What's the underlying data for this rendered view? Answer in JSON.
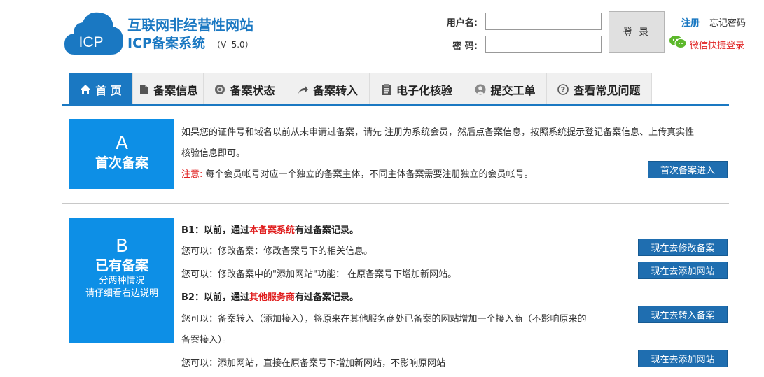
{
  "header": {
    "logo_text": "ICP",
    "site_title": "互联网非经营性网站",
    "sys_title": "ICP备案系统",
    "version": "（V- 5.0）"
  },
  "login": {
    "username_label": "用户名:",
    "password_label": "密 码:",
    "username_value": "",
    "password_value": "",
    "login_button": "登 录",
    "register_link": "注册",
    "forget_link": "忘记密码",
    "wechat_link": "微信快捷登录"
  },
  "nav": {
    "items": [
      {
        "label": "首 页",
        "icon": "home-icon"
      },
      {
        "label": "备案信息",
        "icon": "document-icon"
      },
      {
        "label": "备案状态",
        "icon": "status-icon"
      },
      {
        "label": "备案转入",
        "icon": "share-arrow-icon"
      },
      {
        "label": "电子化核验",
        "icon": "clipboard-icon"
      },
      {
        "label": "提交工单",
        "icon": "user-icon"
      },
      {
        "label": "查看常见问题",
        "icon": "question-icon"
      }
    ]
  },
  "section_a": {
    "letter": "A",
    "title": "首次备案",
    "desc_line1": "如果您的证件号和域名以前从未申请过备案，请先 注册为系统会员，然后点备案信息，按照系统提示登记备案信息、上传真实性",
    "desc_line2": "核验信息即可。",
    "note_label": "注意:",
    "note_text": " 每个会员帐号对应一个独立的备案主体，不同主体备案需要注册独立的会员帐号。",
    "button": "首次备案进入"
  },
  "section_b": {
    "letter": "B",
    "title": "已有备案",
    "sub1": "分两种情况",
    "sub2": "请仔细看右边说明",
    "b1_prefix": "B1：以前，通过",
    "b1_highlight": "本备案系统",
    "b1_suffix": "有过备案记录。",
    "b1_line1": "您可以：修改备案：修改备案号下的相关信息。",
    "b1_line2": "您可以：修改备案中的\"添加网站\"功能：  在原备案号下增加新网站。",
    "b1_btn1": "现在去修改备案",
    "b1_btn2": "现在去添加网站",
    "b2_prefix": "B2：以前，通过",
    "b2_highlight": "其他服务商",
    "b2_suffix": "有过备案记录。",
    "b2_line1": "您可以：备案转入（添加接入），将原来在其他服务商处已备案的网站增加一个接入商（不影响原来的",
    "b2_line1b": "备案接入）。",
    "b2_line2": "您可以：添加网站，直接在原备案号下增加新网站，不影响原网站",
    "b2_btn1": "现在去转入备案",
    "b2_btn2": "现在去添加网站"
  },
  "colors": {
    "primary": "#1a78c2",
    "box_blue": "#0d8fe6",
    "button_blue": "#1f6eb0",
    "highlight_red": "#e02020"
  }
}
